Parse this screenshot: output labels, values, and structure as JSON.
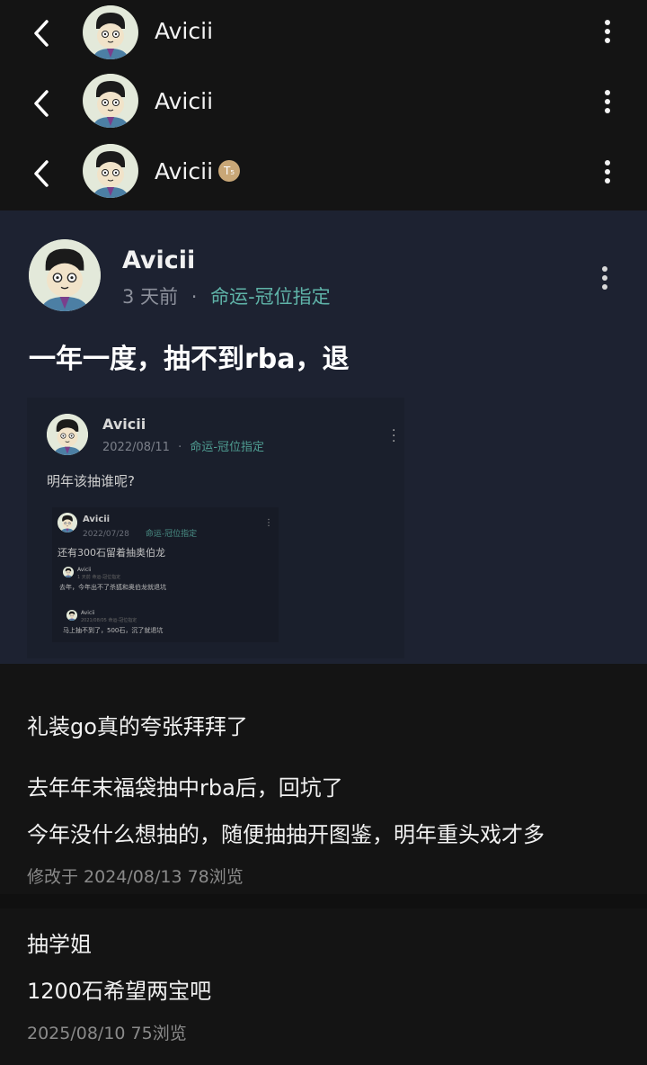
{
  "headers": [
    {
      "name": "Avicii",
      "badge": ""
    },
    {
      "name": "Avicii",
      "badge": ""
    },
    {
      "name": "Avicii",
      "badge": "T₅"
    }
  ],
  "post": {
    "author": "Avicii",
    "time": "3 天前",
    "separator": "·",
    "tag": "命运-冠位指定",
    "title": "一年一度，抽不到rba，退"
  },
  "quoted": {
    "author": "Avicii",
    "date": "2022/08/11",
    "separator": "·",
    "tag": "命运-冠位指定",
    "text": "明年该抽谁呢?",
    "nested": {
      "author": "Avicii",
      "date": "2022/07/28",
      "tag": "命运-冠位指定",
      "text": "还有300石留着抽奥伯龙",
      "inner1": {
        "author": "Avicii",
        "time": "1 天前",
        "tag": "命运-冠位指定",
        "text": "去年，今年出不了杀狐和奥伯龙就退坑"
      },
      "inner2": {
        "author": "Avicii",
        "date": "2021/08/05",
        "tag": "命运-冠位指定",
        "text": "马上抽不到了，500石，沉了就退坑"
      }
    }
  },
  "comments": {
    "c1": {
      "line1": "礼装go真的夸张拜拜了"
    },
    "c2": {
      "line1": "去年年末福袋抽中rba后，回坑了",
      "line2": "今年没什么想抽的，随便抽抽开图鉴，明年重头戏才多",
      "meta": "修改于 2024/08/13  78浏览"
    },
    "c3": {
      "line1": "抽学姐",
      "line2": "1200石希望两宝吧",
      "meta": "2025/08/10  75浏览"
    }
  },
  "colors": {
    "background": "#141414",
    "post_bg": "#1d2231",
    "tag": "#5fb3a8",
    "meta": "#8a8a8a"
  },
  "icons": [
    "back-arrow-icon",
    "more-vertical-icon",
    "avatar"
  ]
}
